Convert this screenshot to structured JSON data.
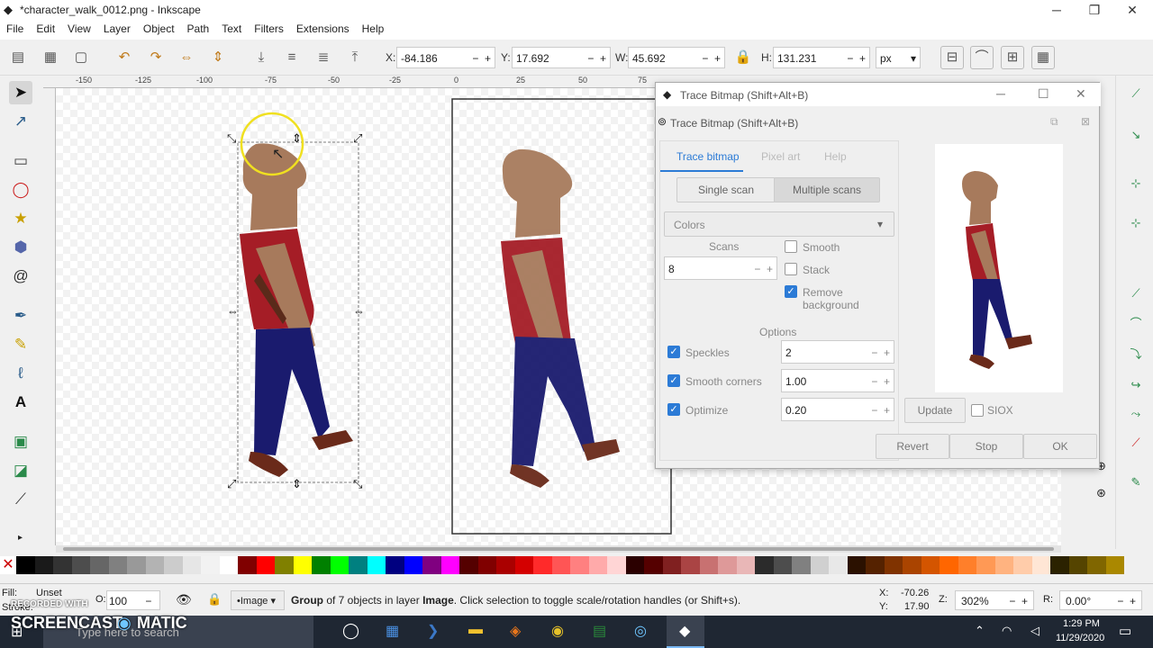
{
  "window": {
    "title": "*character_walk_0012.png - Inkscape",
    "minimize": "─",
    "restore": "❐",
    "close": "✕"
  },
  "menu": [
    "File",
    "Edit",
    "View",
    "Layer",
    "Object",
    "Path",
    "Text",
    "Filters",
    "Extensions",
    "Help"
  ],
  "toolbar": {
    "x_label": "X:",
    "x_value": "-84.186",
    "y_label": "Y:",
    "y_value": "17.692",
    "w_label": "W:",
    "w_value": "45.692",
    "h_label": "H:",
    "h_value": "131.231",
    "unit": "px"
  },
  "ruler_ticks": [
    "-150",
    "-125",
    "-100",
    "-75",
    "-50",
    "-25",
    "0",
    "25",
    "50",
    "75"
  ],
  "dialog": {
    "title": "Trace Bitmap (Shift+Alt+B)",
    "subtitle": "Trace Bitmap (Shift+Alt+B)",
    "tabs": [
      "Trace bitmap",
      "Pixel art",
      "Help"
    ],
    "scan_modes": [
      "Single scan",
      "Multiple scans"
    ],
    "mode_select": "Colors",
    "scans_label": "Scans",
    "scans_value": "8",
    "smooth_label": "Smooth",
    "stack_label": "Stack",
    "remove_bg_label": "Remove background",
    "options_label": "Options",
    "speckles_label": "Speckles",
    "speckles_value": "2",
    "smooth_corners_label": "Smooth corners",
    "smooth_corners_value": "1.00",
    "optimize_label": "Optimize",
    "optimize_value": "0.20",
    "update_label": "Update",
    "siox_label": "SIOX",
    "revert_label": "Revert",
    "stop_label": "Stop",
    "ok_label": "OK"
  },
  "status": {
    "fill_label": "Fill:",
    "fill_value": "Unset",
    "stroke_label": "Stroke:",
    "opacity_label": "O:",
    "opacity_value": "100",
    "layer": "•Image",
    "message_bold": "Group",
    "message": " of 7 objects in layer ",
    "message_bold2": "Image",
    "message_end": ". Click selection to toggle scale/rotation handles (or Shift+s).",
    "cursor_x_label": "X:",
    "cursor_x": "-70.26",
    "cursor_y_label": "Y:",
    "cursor_y": "17.90",
    "zoom_label": "Z:",
    "zoom": "302%",
    "rot_label": "R:",
    "rotation": "0.00°"
  },
  "watermark": {
    "top": "RECORDED WITH",
    "brand": "SCREENCAST",
    "brand2": "MATIC"
  },
  "taskbar": {
    "search": "Type here to search",
    "time": "1:29 PM",
    "date": "11/29/2020"
  },
  "palette": [
    "#000000",
    "#1a1a1a",
    "#333333",
    "#4d4d4d",
    "#666666",
    "#808080",
    "#999999",
    "#b3b3b3",
    "#cccccc",
    "#e6e6e6",
    "#f2f2f2",
    "#ffffff",
    "#800000",
    "#ff0000",
    "#808000",
    "#ffff00",
    "#008000",
    "#00ff00",
    "#008080",
    "#00ffff",
    "#000080",
    "#0000ff",
    "#800080",
    "#ff00ff",
    "#550000",
    "#800000",
    "#aa0000",
    "#d40000",
    "#ff2a2a",
    "#ff5555",
    "#ff8080",
    "#ffaaaa",
    "#ffd5d5",
    "#2b0000",
    "#550000",
    "#802020",
    "#aa4444",
    "#c87171",
    "#de9999",
    "#e9b7b7",
    "#2b2b2b",
    "#4d4d4d",
    "#808080",
    "#d0d0d0",
    "#e8e8e8",
    "#2b1100",
    "#552200",
    "#803300",
    "#aa4400",
    "#d45500",
    "#ff6600",
    "#ff7f2a",
    "#ff9955",
    "#ffb380",
    "#ffccaa",
    "#ffe6d5",
    "#2b2200",
    "#554400",
    "#806600",
    "#aa8800"
  ]
}
